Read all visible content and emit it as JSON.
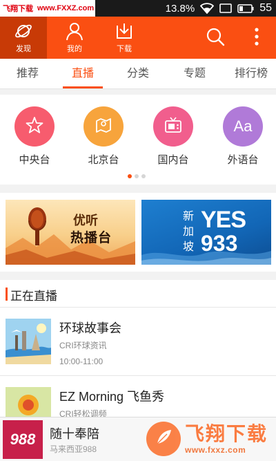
{
  "status_bar": {
    "watermark_left": "飞翔下载",
    "watermark_url": "www.FXXZ.com",
    "battery_percent": "13.8%",
    "time": "55"
  },
  "top_nav": {
    "items": [
      {
        "label": "发现",
        "icon": "planet-icon",
        "active": true
      },
      {
        "label": "我的",
        "icon": "user-icon",
        "active": false
      },
      {
        "label": "下载",
        "icon": "download-icon",
        "active": false
      }
    ],
    "actions": [
      "search-icon",
      "more-vertical-icon"
    ]
  },
  "tabs": {
    "items": [
      "推荐",
      "直播",
      "分类",
      "专题",
      "排行榜"
    ],
    "active_index": 1
  },
  "categories": [
    {
      "label": "中央台",
      "icon": "star-icon",
      "color": "#f75c6e"
    },
    {
      "label": "北京台",
      "icon": "map-icon",
      "color": "#f7a43c"
    },
    {
      "label": "国内台",
      "icon": "tv-icon",
      "color": "#f15e8d"
    },
    {
      "label": "外语台",
      "icon": "font-icon",
      "glyph": "Aa",
      "color": "#b07ad8"
    }
  ],
  "carousel": {
    "pages": 3,
    "active": 0
  },
  "banners": [
    {
      "line1": "优听",
      "line2": "热播台"
    },
    {
      "vertical": "新加坡",
      "line1": "YES",
      "line2": "933"
    }
  ],
  "live": {
    "title": "正在直播",
    "programs": [
      {
        "name": "环球故事会",
        "source": "CRI环球资讯",
        "time": "10:00-11:00"
      },
      {
        "name": "EZ Morning 飞鱼秀",
        "source": "CRI轻松调频",
        "time": ""
      }
    ]
  },
  "player": {
    "cover_text": "988",
    "title": "随十奉陪",
    "subtitle": "马来西亚988"
  },
  "watermark_bottom": {
    "title": "飞翔下载",
    "url": "www.fxxz.com"
  },
  "colors": {
    "accent": "#fa4f12",
    "accent_dark": "#c83a06"
  }
}
